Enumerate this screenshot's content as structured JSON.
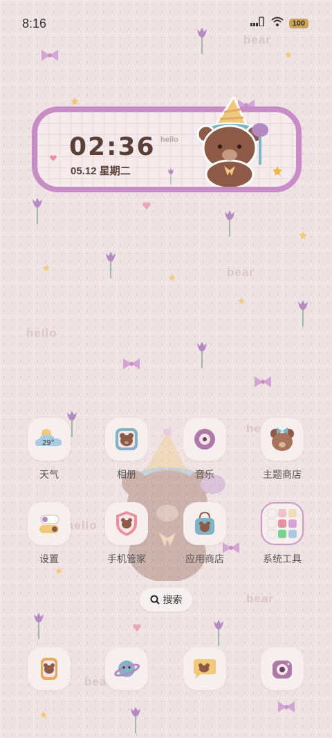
{
  "status_bar": {
    "time": "8:16",
    "battery": "100"
  },
  "widget": {
    "time": "02:36",
    "date": "05.12 星期二",
    "hello": "hello"
  },
  "watermarks": [
    "bear",
    "bear",
    "hello",
    "hello",
    "hello",
    "bear",
    "bear"
  ],
  "apps": [
    {
      "label": "天气",
      "weather_temp": "29°"
    },
    {
      "label": "相册"
    },
    {
      "label": "音乐"
    },
    {
      "label": "主题商店"
    },
    {
      "label": "设置"
    },
    {
      "label": "手机管家"
    },
    {
      "label": "应用商店"
    },
    {
      "label": "系统工具"
    }
  ],
  "search": {
    "label": "搜索"
  },
  "colors": {
    "widget_border": "#c88cc6",
    "background": "#efe2e3",
    "accent_purple": "#b58ac4"
  }
}
